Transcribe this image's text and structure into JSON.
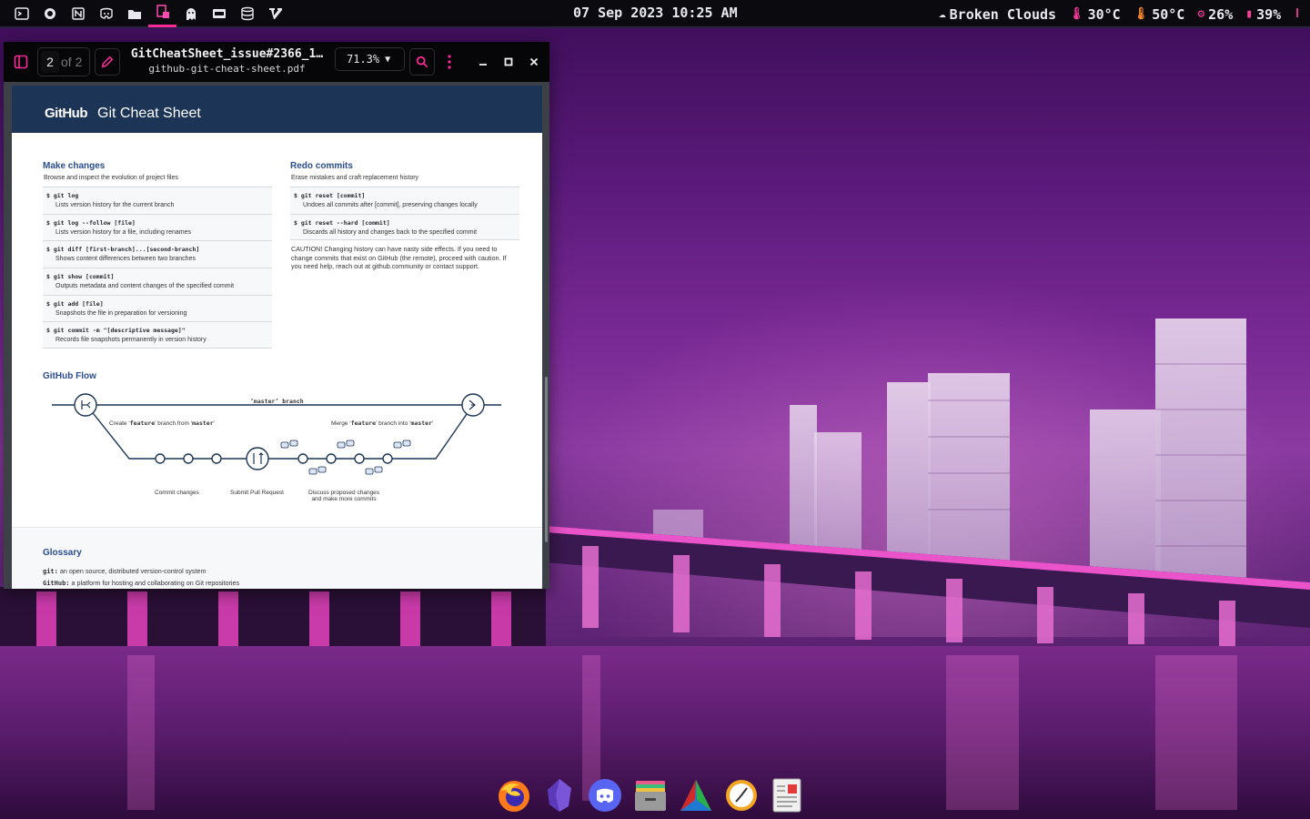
{
  "topbar": {
    "icons": [
      "terminal-icon",
      "refresh-icon",
      "notion-icon",
      "discord-icon",
      "folder-icon",
      "pdf-viewer-icon",
      "ghost-icon",
      "pdf-icon",
      "database-icon",
      "vim-icon"
    ],
    "active_index": 5,
    "clock": "07 Sep 2023 10:25 AM",
    "weather": "Broken Clouds",
    "temp_outside": "30°C",
    "temp_cpu": "50°C",
    "cpu": "26%",
    "memory": "39%",
    "accent": "#ff2a9a"
  },
  "viewer": {
    "page_current": "2",
    "page_of": "of 2",
    "title": "GitCheatSheet_issue#2366_1…",
    "filename": "github-git-cheat-sheet.pdf",
    "zoom": "71.3%"
  },
  "doc": {
    "logo": "GitHub",
    "title": "Git Cheat Sheet",
    "make_changes": {
      "title": "Make changes",
      "subtitle": "Browse and inspect the evolution of project files",
      "items": [
        {
          "cmd": "$ git log",
          "desc": "Lists version history for the current branch"
        },
        {
          "cmd": "$ git log --follow [file]",
          "desc": "Lists version history for a file, including renames"
        },
        {
          "cmd": "$ git diff [first-branch]...[second-branch]",
          "desc": "Shows content differences between two branches"
        },
        {
          "cmd": "$ git show [commit]",
          "desc": "Outputs metadata and content changes of the specified commit"
        },
        {
          "cmd": "$ git add [file]",
          "desc": "Snapshots the file in preparation for versioning"
        },
        {
          "cmd": "$ git commit -m \"[descriptive message]\"",
          "desc": "Records file snapshots permanently in version history"
        }
      ]
    },
    "redo_commits": {
      "title": "Redo commits",
      "subtitle": "Erase mistakes and craft replacement history",
      "items": [
        {
          "cmd": "$ git reset [commit]",
          "desc": "Undoes all commits after [commit], preserving changes locally"
        },
        {
          "cmd": "$ git reset --hard [commit]",
          "desc": "Discards all history and changes back to the specified commit"
        }
      ],
      "caution": "CAUTION! Changing history can have nasty side effects. If you need to change commits that exist on GitHub (the remote), proceed with caution. If you need help, reach out at github.community or contact support."
    },
    "flow": {
      "title": "GitHub Flow",
      "master_branch": "‘master’ branch",
      "create_pre": "Create ‘",
      "create_code1": "feature",
      "create_mid": "’ branch from ‘",
      "create_code2": "master",
      "create_post": "’",
      "merge_pre": "Merge ‘",
      "merge_code1": "feature",
      "merge_mid": "’ branch into ‘",
      "merge_code2": "master",
      "merge_post": "’",
      "commit_changes": "Commit changes",
      "submit_pr": "Submit Pull Request",
      "discuss_1": "Discuss proposed changes",
      "discuss_2": "and make more commits"
    },
    "glossary": {
      "title": "Glossary",
      "items": [
        {
          "term": "git:",
          "def": " an open source, distributed version-control system"
        },
        {
          "term": "GitHub:",
          "def": " a platform for hosting and collaborating on Git repositories"
        }
      ]
    }
  },
  "dock": {
    "apps": [
      "firefox-icon",
      "obsidian-icon",
      "discord-icon",
      "archive-manager-icon",
      "cmake-icon",
      "clock-icon",
      "document-viewer-icon"
    ]
  }
}
